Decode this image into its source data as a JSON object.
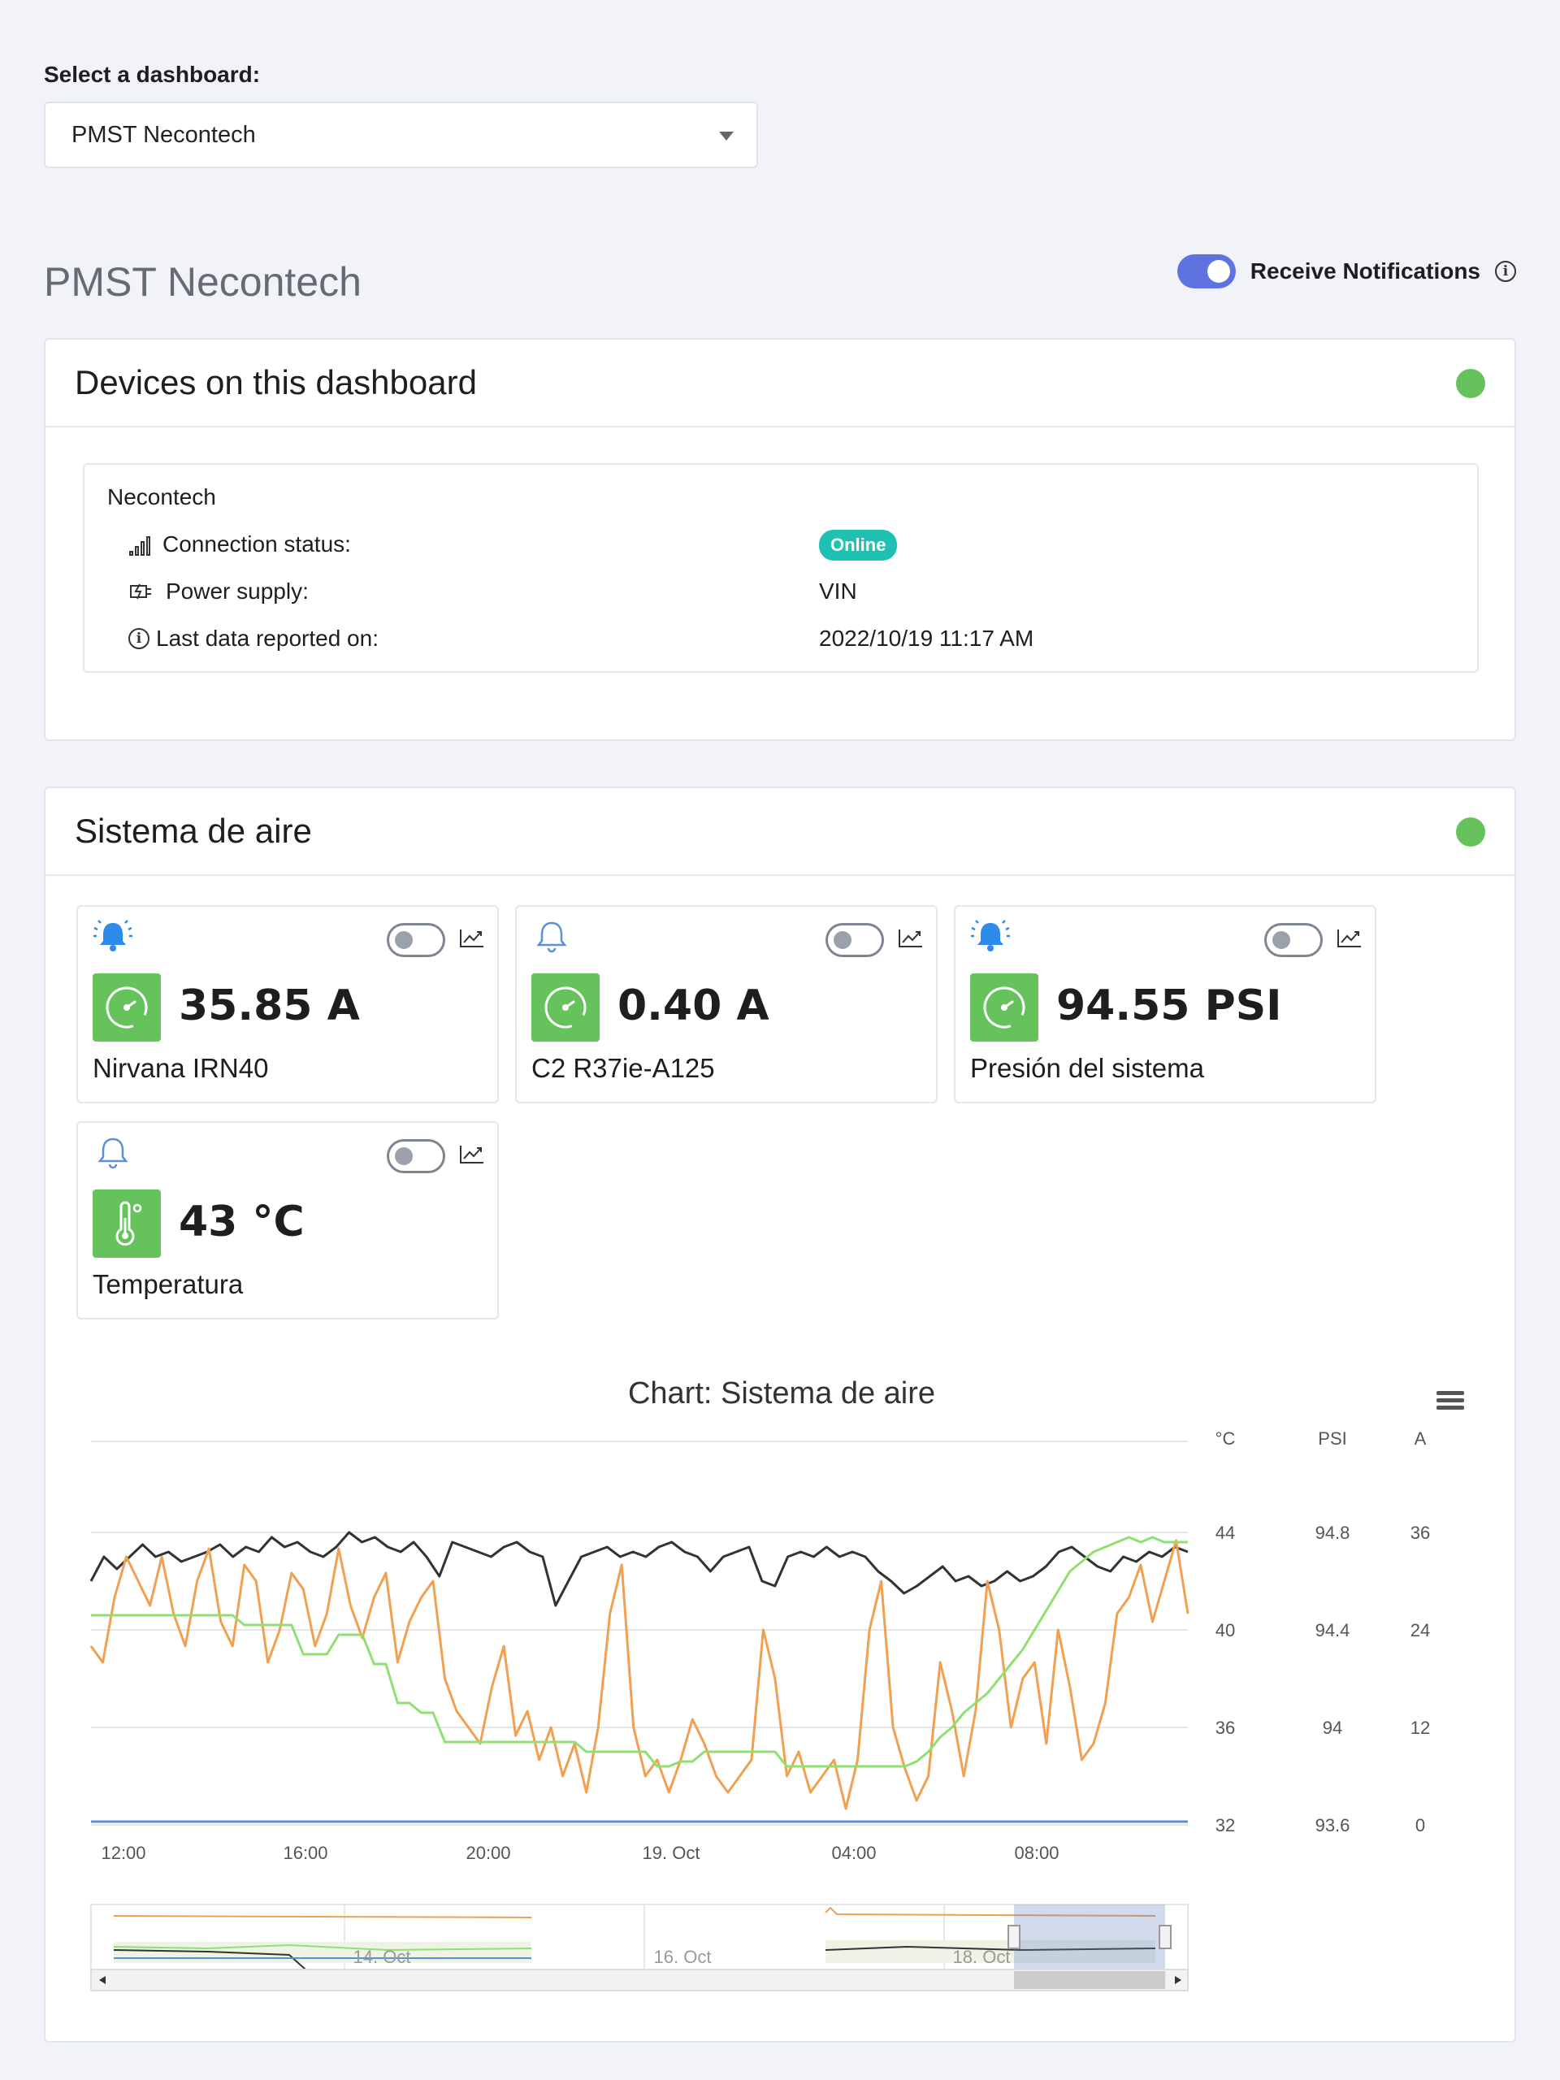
{
  "selector": {
    "label": "Select a dashboard:",
    "value": "PMST Necontech"
  },
  "page": {
    "title": "PMST Necontech",
    "notifications_label": "Receive Notifications",
    "notifications_on": true
  },
  "devices_card": {
    "title": "Devices on this dashboard",
    "status_color": "#66c35c",
    "device": {
      "name": "Necontech",
      "rows": [
        {
          "icon": "signal-icon",
          "label": "Connection status:",
          "value": "Online",
          "is_badge": true
        },
        {
          "icon": "power-plug-icon",
          "label": "Power supply:",
          "value": "VIN",
          "is_badge": false
        },
        {
          "icon": "info-icon",
          "label": "Last data reported on:",
          "value": "2022/10/19 11:17 AM",
          "is_badge": false
        }
      ]
    }
  },
  "system_card": {
    "title": "Sistema de aire",
    "status_color": "#66c35c",
    "widgets": [
      {
        "value": "35.85 A",
        "name": "Nirvana IRN40",
        "icon": "gauge-icon",
        "bell": "bell-ringing-icon",
        "alert": false
      },
      {
        "value": "0.40 A",
        "name": "C2 R37ie-A125",
        "icon": "gauge-icon",
        "bell": "bell-outline-icon",
        "alert": false
      },
      {
        "value": "94.55 PSI",
        "name": "Presión del sistema",
        "icon": "gauge-icon",
        "bell": "bell-ringing-icon",
        "alert": false
      },
      {
        "value": "43 °C",
        "name": "Temperatura",
        "icon": "thermometer-icon",
        "bell": "bell-outline-icon",
        "alert": false
      }
    ]
  },
  "chart_data": {
    "type": "line",
    "title": "Chart: Sistema de aire",
    "x_ticks": [
      "12:00",
      "16:00",
      "20:00",
      "19. Oct",
      "04:00",
      "08:00"
    ],
    "y_axes": [
      {
        "unit": "°C",
        "ticks": [
          "44",
          "40",
          "36",
          "32"
        ],
        "range": [
          32,
          44
        ]
      },
      {
        "unit": "PSI",
        "ticks": [
          "94.8",
          "94.4",
          "94",
          "93.6"
        ],
        "range": [
          93.6,
          94.8
        ]
      },
      {
        "unit": "A",
        "ticks": [
          "36",
          "24",
          "12",
          "0"
        ],
        "range": [
          0,
          36
        ]
      }
    ],
    "series": [
      {
        "color": "#333333",
        "axis": "PSI",
        "values": [
          94.6,
          94.7,
          94.65,
          94.7,
          94.75,
          94.7,
          94.72,
          94.68,
          94.7,
          94.72,
          94.75,
          94.7,
          94.74,
          94.72,
          94.78,
          94.74,
          94.76,
          94.72,
          94.7,
          94.74,
          94.8,
          94.76,
          94.78,
          94.74,
          94.72,
          94.76,
          94.7,
          94.62,
          94.76,
          94.74,
          94.72,
          94.7,
          94.74,
          94.76,
          94.72,
          94.7,
          94.5,
          94.6,
          94.7,
          94.72,
          94.74,
          94.7,
          94.72,
          94.7,
          94.74,
          94.76,
          94.72,
          94.7,
          94.64,
          94.7,
          94.72,
          94.74,
          94.6,
          94.58,
          94.7,
          94.72,
          94.7,
          94.74,
          94.7,
          94.72,
          94.7,
          94.64,
          94.6,
          94.55,
          94.58,
          94.62,
          94.66,
          94.6,
          94.62,
          94.58,
          94.6,
          94.64,
          94.6,
          94.62,
          94.66,
          94.72,
          94.74,
          94.7,
          94.66,
          94.64,
          94.7,
          94.68,
          94.72,
          94.7,
          94.74,
          94.72
        ]
      },
      {
        "color": "#f0a050",
        "axis": "A",
        "values": [
          22,
          20,
          28,
          33,
          30,
          27,
          33,
          26,
          22,
          30,
          34,
          25,
          22,
          32,
          30,
          20,
          24,
          31,
          29,
          22,
          26,
          34,
          27,
          23,
          28,
          31,
          20,
          25,
          28,
          30,
          18,
          14,
          12,
          10,
          17,
          22,
          11,
          14,
          8,
          12,
          6,
          10,
          4,
          12,
          26,
          32,
          12,
          6,
          8,
          4,
          8,
          13,
          10,
          6,
          4,
          6,
          8,
          24,
          18,
          6,
          9,
          4,
          6,
          8,
          2,
          8,
          24,
          30,
          12,
          7,
          3,
          6,
          20,
          14,
          6,
          14,
          30,
          24,
          12,
          18,
          20,
          10,
          24,
          17,
          8,
          10,
          15,
          26,
          28,
          32,
          25,
          30,
          35,
          26
        ]
      },
      {
        "color": "#8ee070",
        "axis": "°C",
        "values": [
          40.6,
          40.6,
          40.6,
          40.6,
          40.6,
          40.6,
          40.6,
          40.6,
          40.6,
          40.6,
          40.6,
          40.6,
          40.6,
          40.2,
          40.2,
          40.2,
          40.2,
          40.2,
          39.0,
          39.0,
          39.0,
          39.8,
          39.8,
          39.8,
          38.6,
          38.6,
          37.0,
          37.0,
          36.6,
          36.6,
          35.4,
          35.4,
          35.4,
          35.4,
          35.4,
          35.4,
          35.4,
          35.4,
          35.4,
          35.4,
          35.4,
          35.4,
          35.0,
          35.0,
          35.0,
          35.0,
          35.0,
          35.0,
          34.4,
          34.4,
          34.6,
          34.6,
          35.0,
          35.0,
          35.0,
          35.0,
          35.0,
          35.0,
          35.0,
          34.4,
          34.4,
          34.4,
          34.4,
          34.4,
          34.4,
          34.4,
          34.4,
          34.4,
          34.4,
          34.4,
          34.6,
          35.0,
          35.6,
          36.0,
          36.6,
          37.0,
          37.4,
          38.0,
          38.6,
          39.2,
          40.0,
          40.8,
          41.6,
          42.4,
          42.8,
          43.2,
          43.4,
          43.6,
          43.8,
          43.6,
          43.8,
          43.6,
          43.6,
          43.6
        ]
      },
      {
        "color": "#5b8fd6",
        "axis": "A",
        "values": [
          0.4,
          0.4,
          0.4,
          0.4,
          0.4,
          0.4,
          0.4,
          0.4,
          0.4,
          0.4
        ]
      }
    ],
    "navigator_labels": [
      "14. Oct",
      "16. Oct",
      "18. Oct"
    ],
    "legend": "none",
    "grid": true
  }
}
